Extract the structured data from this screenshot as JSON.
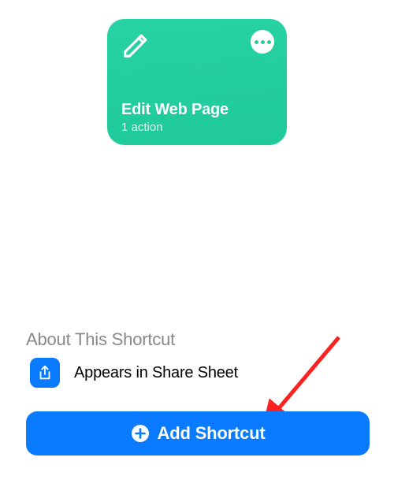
{
  "shortcut": {
    "title": "Edit Web Page",
    "subtitle": "1 action"
  },
  "section": {
    "header": "About This Shortcut",
    "share_label": "Appears in Share Sheet"
  },
  "add_button": {
    "label": "Add Shortcut"
  }
}
